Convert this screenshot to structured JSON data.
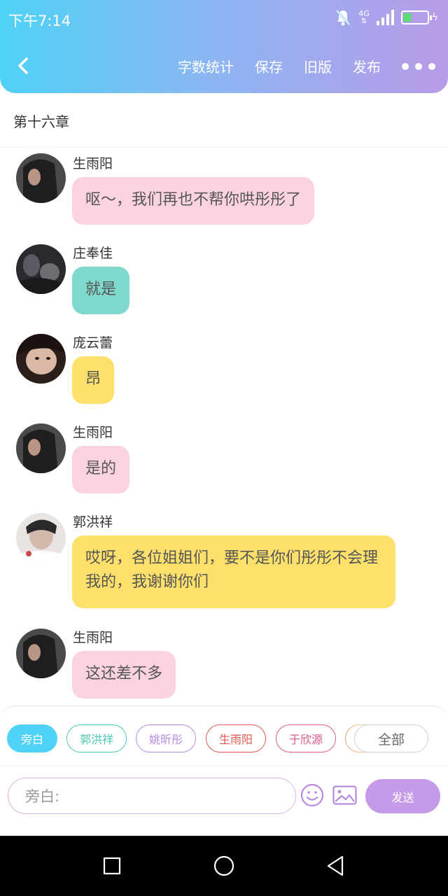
{
  "status_bar": {
    "time": "下午7:14",
    "network": "4G",
    "battery_level": 0.3
  },
  "toolbar": {
    "word_count": "字数统计",
    "save": "保存",
    "old_version": "旧版",
    "publish": "发布"
  },
  "chapter": {
    "title": "第十六章"
  },
  "messages": [
    {
      "name": "生雨阳",
      "text": "呕～，我们再也不帮你哄彤彤了",
      "color": "pink"
    },
    {
      "name": "庄奉佳",
      "text": "就是",
      "color": "teal"
    },
    {
      "name": "庞云蕾",
      "text": "昂",
      "color": "yellow"
    },
    {
      "name": "生雨阳",
      "text": "是的",
      "color": "pink"
    },
    {
      "name": "郭洪祥",
      "text": "哎呀，各位姐姐们，要不是你们彤彤不会理我的，我谢谢你们",
      "color": "yellow"
    },
    {
      "name": "生雨阳",
      "text": "这还差不多",
      "color": "pink"
    }
  ],
  "characters": [
    {
      "label": "旁白",
      "color": "#4fd2f6"
    },
    {
      "label": "郭洪祥",
      "color": "#4cc6b4"
    },
    {
      "label": "姚昕彤",
      "color": "#b58be0"
    },
    {
      "label": "生雨阳",
      "color": "#e0574f"
    },
    {
      "label": "于欣源",
      "color": "#e0588c"
    }
  ],
  "all_label": "全部",
  "composer": {
    "placeholder": "旁白:",
    "send_label": "发送"
  }
}
